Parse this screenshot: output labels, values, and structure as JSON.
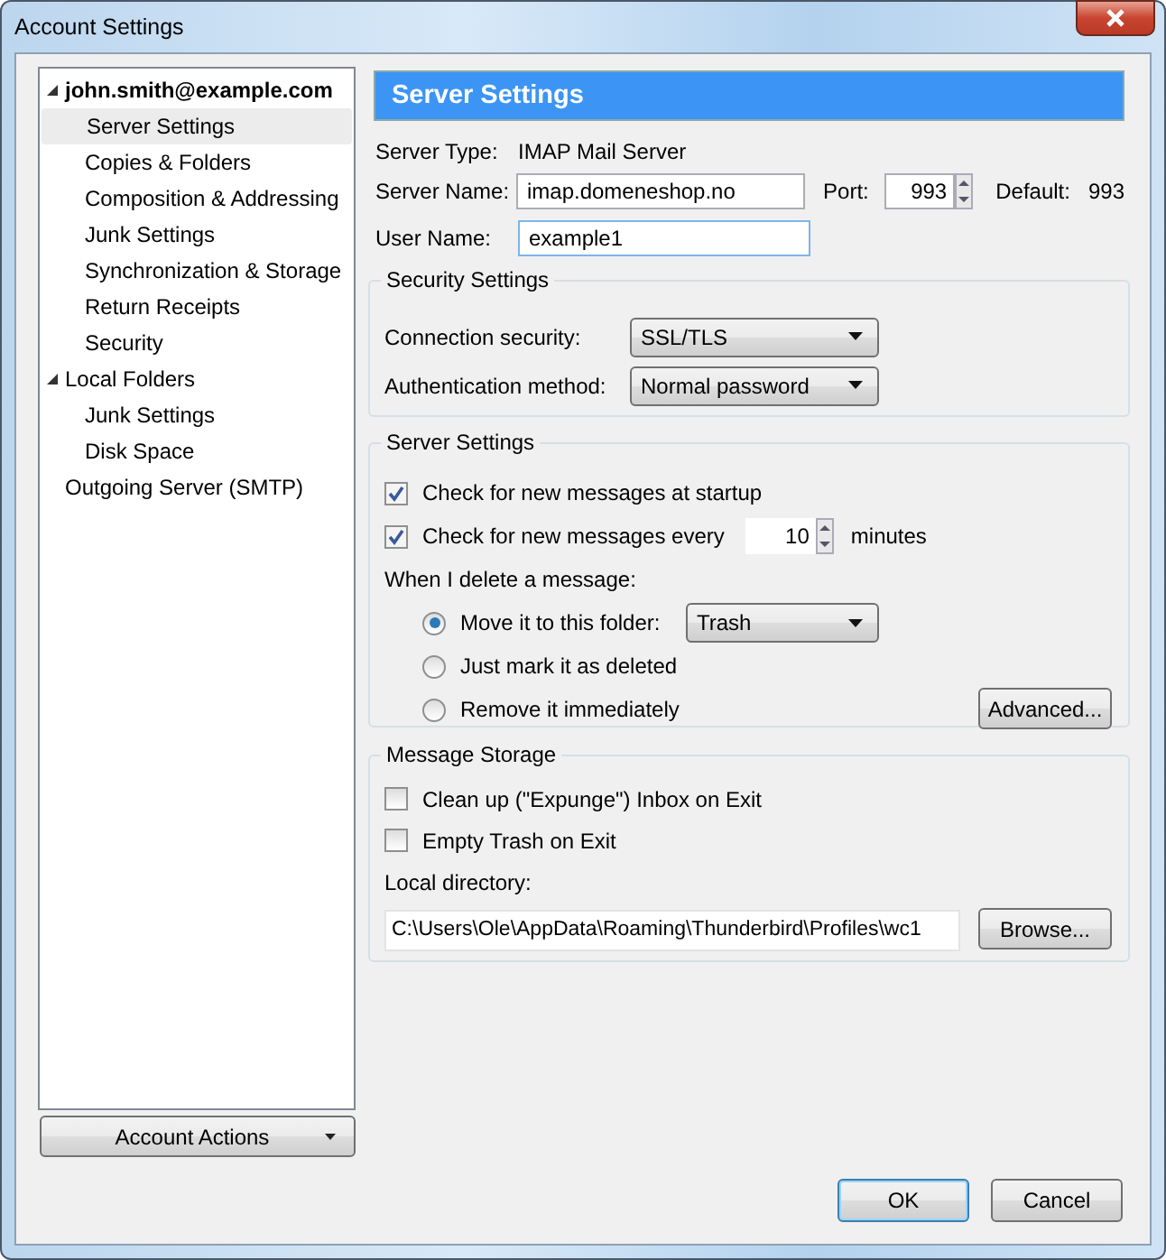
{
  "window": {
    "title": "Account Settings"
  },
  "tree": [
    {
      "label": "john.smith@example.com",
      "expanded": true,
      "selected": false,
      "children": [
        {
          "label": "Server Settings",
          "selected": true
        },
        {
          "label": "Copies & Folders",
          "selected": false
        },
        {
          "label": "Composition & Addressing",
          "selected": false
        },
        {
          "label": "Junk Settings",
          "selected": false
        },
        {
          "label": "Synchronization & Storage",
          "selected": false
        },
        {
          "label": "Return Receipts",
          "selected": false
        },
        {
          "label": "Security",
          "selected": false
        }
      ]
    },
    {
      "label": "Local Folders",
      "expanded": true,
      "selected": false,
      "children": [
        {
          "label": "Junk Settings",
          "selected": false
        },
        {
          "label": "Disk Space",
          "selected": false
        }
      ]
    },
    {
      "label": "Outgoing Server (SMTP)",
      "selected": false
    }
  ],
  "account_actions_button": "Account Actions",
  "panel": {
    "title": "Server Settings",
    "server_type": {
      "label": "Server Type:",
      "value": "IMAP Mail Server"
    },
    "server_name": {
      "label": "Server Name:",
      "value": "imap.domeneshop.no"
    },
    "port": {
      "label": "Port:",
      "value": "993"
    },
    "default": {
      "label": "Default:",
      "value": "993"
    },
    "user_name": {
      "label": "User Name:",
      "value": "example1"
    },
    "security": {
      "legend": "Security Settings",
      "rows": [
        {
          "label": "Connection security:",
          "value": "SSL/TLS"
        },
        {
          "label": "Authentication method:",
          "value": "Normal password"
        }
      ]
    },
    "server_settings": {
      "legend": "Server Settings",
      "check_startup": {
        "label": "Check for new messages at startup",
        "checked": true
      },
      "check_every": {
        "label": "Check for new messages every",
        "checked": true,
        "value": "10",
        "unit": "minutes"
      },
      "delete_label": "When I delete a message:",
      "delete_options": [
        {
          "label": "Move it to this folder:",
          "selected": true,
          "folder": "Trash"
        },
        {
          "label": "Just mark it as deleted",
          "selected": false
        },
        {
          "label": "Remove it immediately",
          "selected": false
        }
      ],
      "advanced_button": "Advanced..."
    },
    "message_storage": {
      "legend": "Message Storage",
      "options": [
        {
          "label": "Clean up (\"Expunge\") Inbox on Exit",
          "checked": false
        },
        {
          "label": "Empty Trash on Exit",
          "checked": false
        }
      ],
      "local_directory": {
        "label": "Local directory:",
        "value": "C:\\Users\\Ole\\AppData\\Roaming\\Thunderbird\\Profiles\\wc1"
      },
      "browse_button": "Browse..."
    }
  },
  "buttons": [
    {
      "label": "OK",
      "default": true
    },
    {
      "label": "Cancel",
      "default": false
    }
  ]
}
